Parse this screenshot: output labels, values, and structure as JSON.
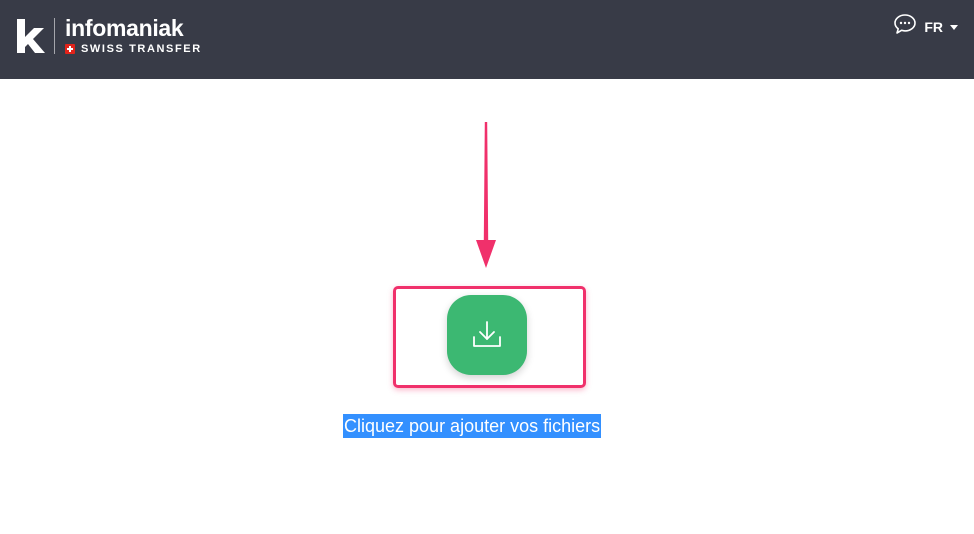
{
  "header": {
    "brand": "infomaniak",
    "product": "SWISS TRANSFER",
    "language": "FR",
    "icons": {
      "logo": "infomaniak-k-logo",
      "flag": "swiss-flag-icon",
      "chat": "chat-bubble-icon",
      "caret": "chevron-down-icon"
    }
  },
  "main": {
    "upload_label": "Cliquez pour ajouter vos fichiers",
    "icons": {
      "upload": "download-tray-icon",
      "annotation_arrow": "arrow-down-icon"
    }
  },
  "colors": {
    "header_bg": "#383b47",
    "upload_button": "#3cb872",
    "annotation": "#f0306b",
    "text_selection": "#3390ff"
  }
}
